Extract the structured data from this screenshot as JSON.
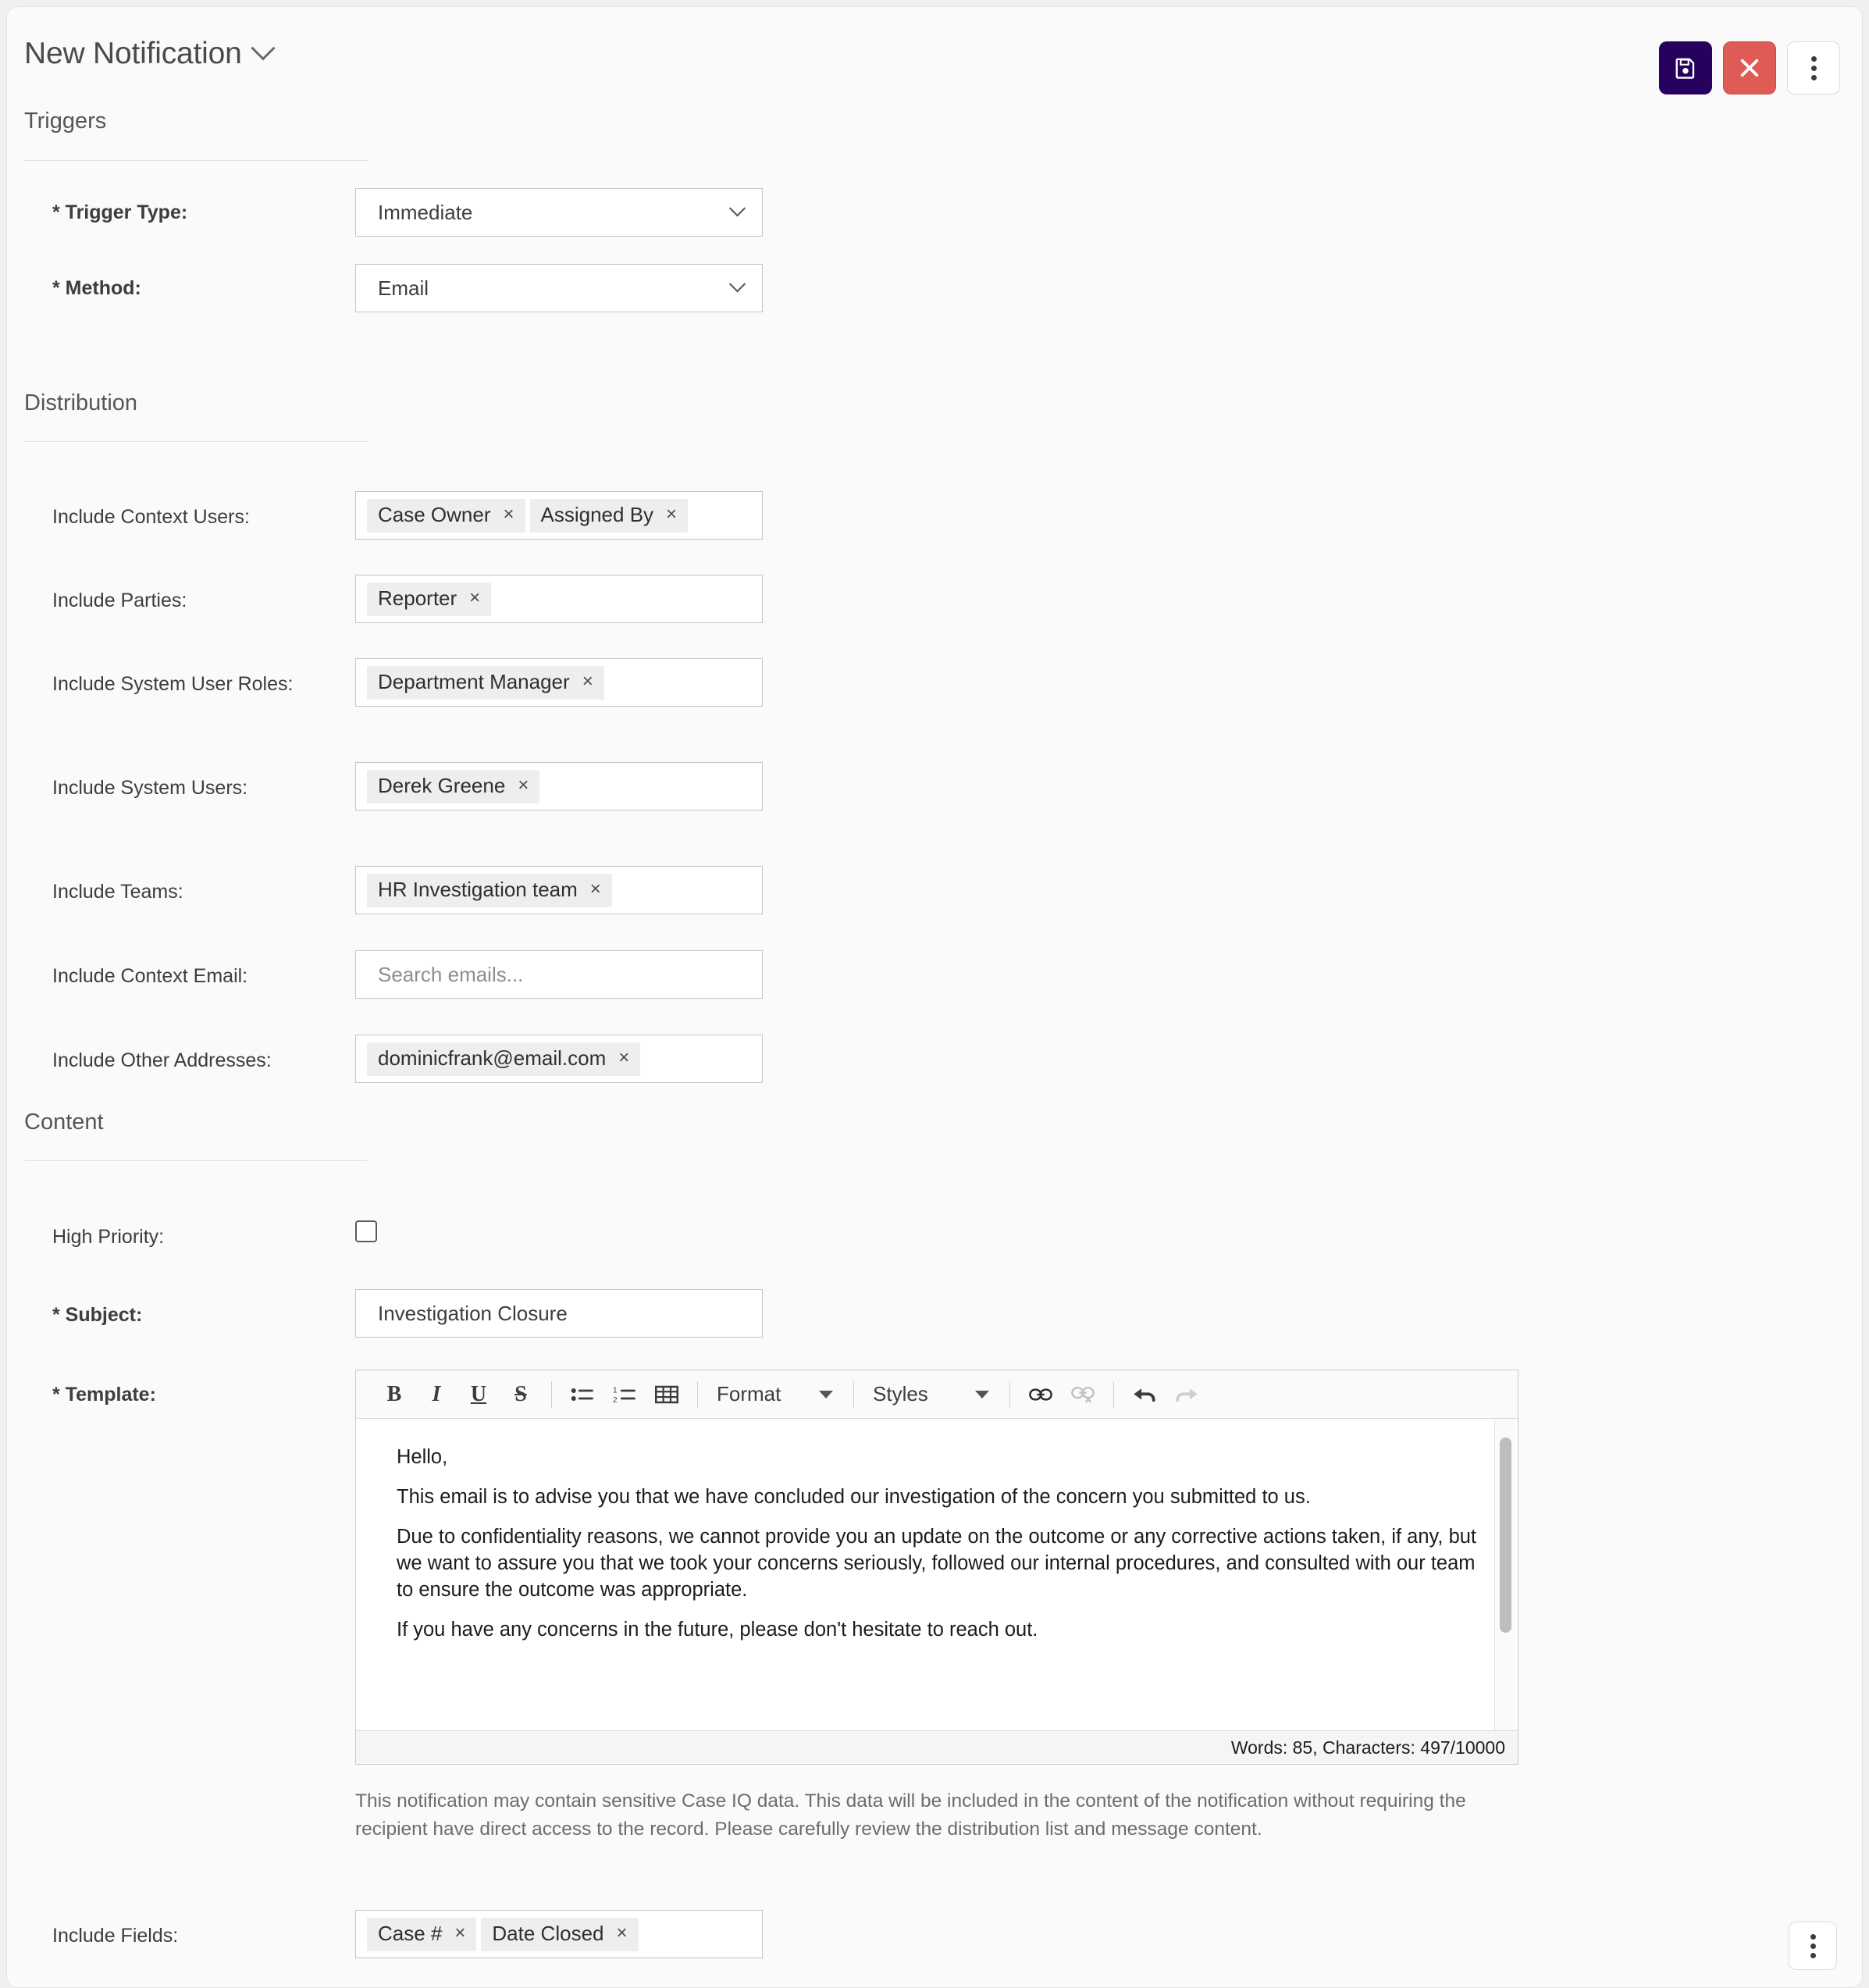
{
  "header": {
    "title": "New Notification",
    "dropdown_icon": "chevron-down-icon",
    "save_icon": "save-floppy-icon",
    "close_icon": "close-x-icon",
    "more_icon": "kebab-menu-icon"
  },
  "sections": {
    "triggers": "Triggers",
    "distribution": "Distribution",
    "content": "Content"
  },
  "triggers": {
    "trigger_type": {
      "label": "* Trigger Type:",
      "value": "Immediate"
    },
    "method": {
      "label": "* Method:",
      "value": "Email"
    }
  },
  "distribution": {
    "context_users": {
      "label": "Include Context Users:",
      "chips": [
        "Case Owner",
        "Assigned By"
      ]
    },
    "parties": {
      "label": "Include Parties:",
      "chips": [
        "Reporter"
      ]
    },
    "system_user_roles": {
      "label": "Include System User Roles:",
      "chips": [
        "Department Manager"
      ]
    },
    "system_users": {
      "label": "Include System Users:",
      "chips": [
        "Derek Greene"
      ]
    },
    "teams": {
      "label": "Include Teams:",
      "chips": [
        "HR Investigation team"
      ]
    },
    "context_email": {
      "label": "Include Context Email:",
      "value": "",
      "placeholder": "Search emails..."
    },
    "other_addresses": {
      "label": "Include Other Addresses:",
      "chips": [
        "dominicfrank@email.com"
      ]
    }
  },
  "content": {
    "high_priority": {
      "label": "High Priority:",
      "checked": false
    },
    "subject": {
      "label": "* Subject:",
      "value": "Investigation Closure"
    },
    "template": {
      "label": "* Template:"
    },
    "include_fields": {
      "label": "Include Fields:",
      "chips": [
        "Case #",
        "Date Closed"
      ]
    }
  },
  "editor": {
    "toolbar": {
      "bold": "B",
      "italic": "I",
      "underline": "U",
      "strikethrough": "S",
      "bulleted_list_icon": "bulleted-list-icon",
      "numbered_list_icon": "numbered-list-icon",
      "table_icon": "table-icon",
      "format_label": "Format",
      "styles_label": "Styles",
      "link_icon": "link-icon",
      "unlink_icon": "unlink-icon",
      "undo_icon": "undo-arrow-icon",
      "redo_icon": "redo-arrow-icon"
    },
    "body_paragraphs": [
      "Hello,",
      "This email is to advise you that we have concluded our investigation of the concern you submitted to us.",
      "Due to confidentiality reasons, we cannot provide you an update on the outcome or any corrective actions taken, if any, but we want to assure you that we took your concerns seriously, followed our internal procedures, and consulted with our team to ensure the outcome was appropriate.",
      "If you have any concerns in the future, please don't hesitate to reach out."
    ],
    "status": "Words: 85, Characters: 497/10000"
  },
  "notice": "This notification may contain sensitive Case IQ data. This data will be included in the content of the notification without requiring the recipient have direct access to the record. Please carefully review the distribution list and message content.",
  "footer": {
    "more_icon": "kebab-menu-icon"
  },
  "colors": {
    "save_button": "#26015e",
    "close_button": "#df5b56",
    "page_bg": "#fafafa",
    "chip_bg": "#eeeeee"
  }
}
